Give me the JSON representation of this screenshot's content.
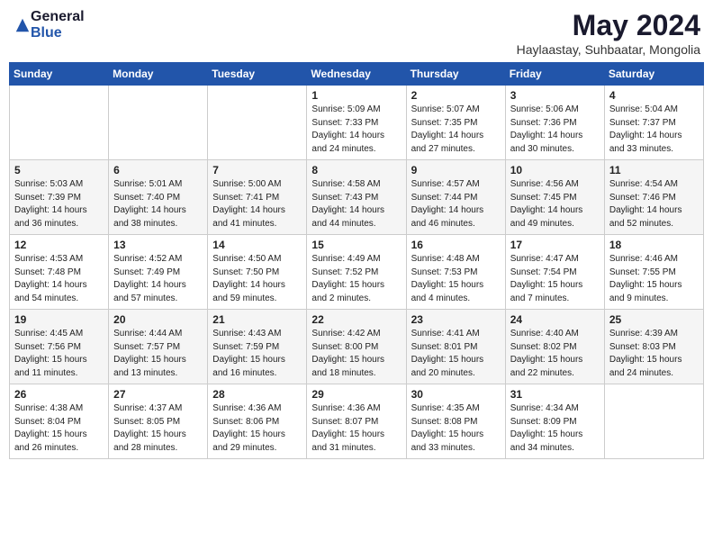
{
  "logo": {
    "general": "General",
    "blue": "Blue"
  },
  "title": "May 2024",
  "subtitle": "Haylaastay, Suhbaatar, Mongolia",
  "days_of_week": [
    "Sunday",
    "Monday",
    "Tuesday",
    "Wednesday",
    "Thursday",
    "Friday",
    "Saturday"
  ],
  "weeks": [
    [
      {
        "day": "",
        "info": ""
      },
      {
        "day": "",
        "info": ""
      },
      {
        "day": "",
        "info": ""
      },
      {
        "day": "1",
        "info": "Sunrise: 5:09 AM\nSunset: 7:33 PM\nDaylight: 14 hours\nand 24 minutes."
      },
      {
        "day": "2",
        "info": "Sunrise: 5:07 AM\nSunset: 7:35 PM\nDaylight: 14 hours\nand 27 minutes."
      },
      {
        "day": "3",
        "info": "Sunrise: 5:06 AM\nSunset: 7:36 PM\nDaylight: 14 hours\nand 30 minutes."
      },
      {
        "day": "4",
        "info": "Sunrise: 5:04 AM\nSunset: 7:37 PM\nDaylight: 14 hours\nand 33 minutes."
      }
    ],
    [
      {
        "day": "5",
        "info": "Sunrise: 5:03 AM\nSunset: 7:39 PM\nDaylight: 14 hours\nand 36 minutes."
      },
      {
        "day": "6",
        "info": "Sunrise: 5:01 AM\nSunset: 7:40 PM\nDaylight: 14 hours\nand 38 minutes."
      },
      {
        "day": "7",
        "info": "Sunrise: 5:00 AM\nSunset: 7:41 PM\nDaylight: 14 hours\nand 41 minutes."
      },
      {
        "day": "8",
        "info": "Sunrise: 4:58 AM\nSunset: 7:43 PM\nDaylight: 14 hours\nand 44 minutes."
      },
      {
        "day": "9",
        "info": "Sunrise: 4:57 AM\nSunset: 7:44 PM\nDaylight: 14 hours\nand 46 minutes."
      },
      {
        "day": "10",
        "info": "Sunrise: 4:56 AM\nSunset: 7:45 PM\nDaylight: 14 hours\nand 49 minutes."
      },
      {
        "day": "11",
        "info": "Sunrise: 4:54 AM\nSunset: 7:46 PM\nDaylight: 14 hours\nand 52 minutes."
      }
    ],
    [
      {
        "day": "12",
        "info": "Sunrise: 4:53 AM\nSunset: 7:48 PM\nDaylight: 14 hours\nand 54 minutes."
      },
      {
        "day": "13",
        "info": "Sunrise: 4:52 AM\nSunset: 7:49 PM\nDaylight: 14 hours\nand 57 minutes."
      },
      {
        "day": "14",
        "info": "Sunrise: 4:50 AM\nSunset: 7:50 PM\nDaylight: 14 hours\nand 59 minutes."
      },
      {
        "day": "15",
        "info": "Sunrise: 4:49 AM\nSunset: 7:52 PM\nDaylight: 15 hours\nand 2 minutes."
      },
      {
        "day": "16",
        "info": "Sunrise: 4:48 AM\nSunset: 7:53 PM\nDaylight: 15 hours\nand 4 minutes."
      },
      {
        "day": "17",
        "info": "Sunrise: 4:47 AM\nSunset: 7:54 PM\nDaylight: 15 hours\nand 7 minutes."
      },
      {
        "day": "18",
        "info": "Sunrise: 4:46 AM\nSunset: 7:55 PM\nDaylight: 15 hours\nand 9 minutes."
      }
    ],
    [
      {
        "day": "19",
        "info": "Sunrise: 4:45 AM\nSunset: 7:56 PM\nDaylight: 15 hours\nand 11 minutes."
      },
      {
        "day": "20",
        "info": "Sunrise: 4:44 AM\nSunset: 7:57 PM\nDaylight: 15 hours\nand 13 minutes."
      },
      {
        "day": "21",
        "info": "Sunrise: 4:43 AM\nSunset: 7:59 PM\nDaylight: 15 hours\nand 16 minutes."
      },
      {
        "day": "22",
        "info": "Sunrise: 4:42 AM\nSunset: 8:00 PM\nDaylight: 15 hours\nand 18 minutes."
      },
      {
        "day": "23",
        "info": "Sunrise: 4:41 AM\nSunset: 8:01 PM\nDaylight: 15 hours\nand 20 minutes."
      },
      {
        "day": "24",
        "info": "Sunrise: 4:40 AM\nSunset: 8:02 PM\nDaylight: 15 hours\nand 22 minutes."
      },
      {
        "day": "25",
        "info": "Sunrise: 4:39 AM\nSunset: 8:03 PM\nDaylight: 15 hours\nand 24 minutes."
      }
    ],
    [
      {
        "day": "26",
        "info": "Sunrise: 4:38 AM\nSunset: 8:04 PM\nDaylight: 15 hours\nand 26 minutes."
      },
      {
        "day": "27",
        "info": "Sunrise: 4:37 AM\nSunset: 8:05 PM\nDaylight: 15 hours\nand 28 minutes."
      },
      {
        "day": "28",
        "info": "Sunrise: 4:36 AM\nSunset: 8:06 PM\nDaylight: 15 hours\nand 29 minutes."
      },
      {
        "day": "29",
        "info": "Sunrise: 4:36 AM\nSunset: 8:07 PM\nDaylight: 15 hours\nand 31 minutes."
      },
      {
        "day": "30",
        "info": "Sunrise: 4:35 AM\nSunset: 8:08 PM\nDaylight: 15 hours\nand 33 minutes."
      },
      {
        "day": "31",
        "info": "Sunrise: 4:34 AM\nSunset: 8:09 PM\nDaylight: 15 hours\nand 34 minutes."
      },
      {
        "day": "",
        "info": ""
      }
    ]
  ]
}
